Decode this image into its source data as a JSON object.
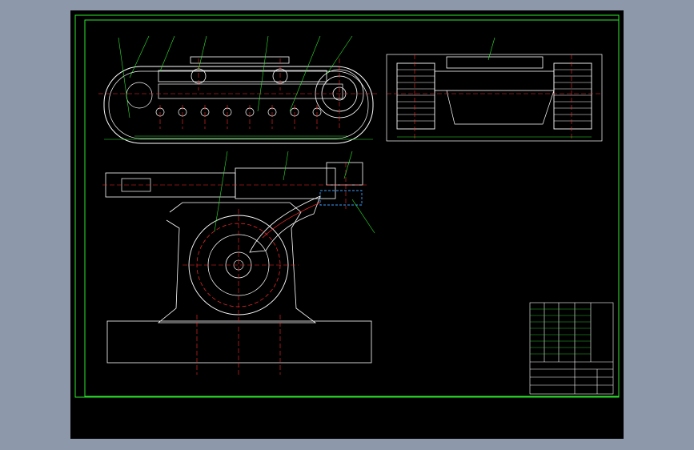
{
  "sheet": {
    "format": "A4"
  },
  "colors": {
    "background_outer": "#8d99ab",
    "canvas": "#000000",
    "border": "#2ee82e",
    "geometry": "#ffffff",
    "centerline": "#ff2a2a",
    "dimension": "#2ee82e",
    "hidden": "#3aa0ff"
  },
  "views": {
    "side_view": {
      "name": "track-side-view"
    },
    "end_view": {
      "name": "track-end-view"
    },
    "section_view": {
      "name": "drive-section-view"
    }
  },
  "title_block": {
    "rows": 9,
    "cols": 6
  }
}
